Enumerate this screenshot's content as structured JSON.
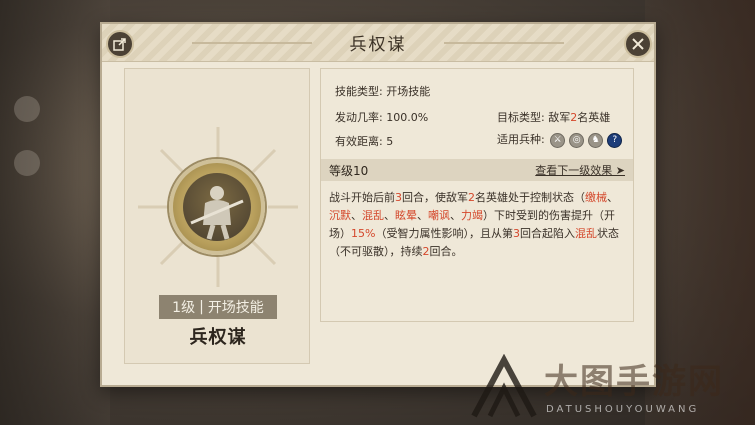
{
  "dialog": {
    "title": "兵权谋"
  },
  "skill": {
    "level_tag": "1级",
    "type_tag": "开场技能",
    "name": "兵权谋"
  },
  "info": {
    "skill_type_label": "技能类型:",
    "skill_type_value": "开场技能",
    "trigger_label": "发动几率:",
    "trigger_value": "100.0%",
    "target_label": "目标类型:",
    "target_prefix": "敌军",
    "target_count": "2",
    "target_suffix": "名英雄",
    "range_label": "有效距离:",
    "range_value": "5",
    "units_label": "适用兵种:",
    "units": [
      "sword-icon",
      "shield-icon",
      "horse-icon",
      "question-icon"
    ]
  },
  "level": {
    "label": "等级10",
    "next_link": "查看下一级效果 ➤"
  },
  "description": {
    "p1": "战斗开始后前",
    "rounds1": "3",
    "p2": "回合，使敌军",
    "count": "2",
    "p3": "名英雄处于控制状态（",
    "s1": "缴械",
    "sep1": "、",
    "s2": "沉默",
    "sep2": "、",
    "s3": "混乱",
    "sep3": "、",
    "s4": "眩晕",
    "sep4": "、",
    "s5": "嘲讽",
    "sep5": "、",
    "s6": "力竭",
    "p4": "）下时受到的伤害提升（开场）",
    "pct": "15%",
    "p5": "（受智力属性影响），且从第",
    "rounds2": "3",
    "p6": "回合起陷入",
    "s7": "混乱",
    "p7": "状态（不可驱散），持续",
    "rounds3": "2",
    "p8": "回合。"
  },
  "watermark": {
    "title": "大图手游网",
    "subtitle": "DATUSHOUYOUWANG"
  },
  "colors": {
    "highlight": "#d4472b",
    "dialog_bg": "#efe8d8"
  }
}
